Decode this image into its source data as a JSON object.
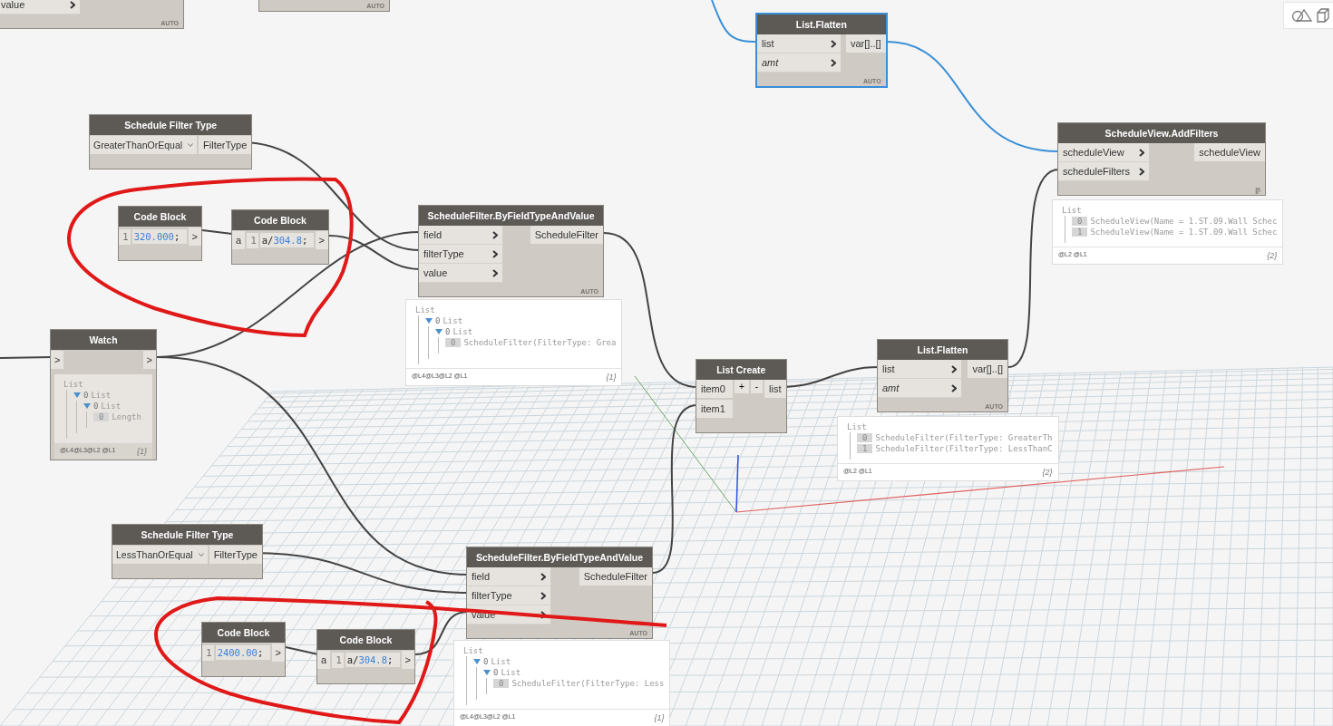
{
  "nodes": [
    {
      "kind": "function",
      "inputs": [
        {
          "label": "value",
          "optional": false
        }
      ],
      "footer": "AUTO"
    },
    {
      "kind": "function",
      "footer": "AUTO"
    },
    {
      "kind": "function",
      "title": "List.Flatten",
      "selected": true,
      "inputs": [
        {
          "label": "list",
          "optional": false
        },
        {
          "label": "amt",
          "optional": true
        }
      ],
      "outputs": [
        "var[]..[]"
      ],
      "footer": "AUTO"
    },
    {
      "kind": "function",
      "title": "ScheduleView.AddFilters",
      "selected": false,
      "inputs": [
        {
          "label": "scheduleView",
          "optional": false
        },
        {
          "label": "scheduleFilters",
          "optional": false
        }
      ],
      "outputs": [
        "scheduleView"
      ],
      "footer": "||\\",
      "preview": {
        "items": [
          {
            "label": "List",
            "children": [
              {
                "index": "0",
                "label": "ScheduleView(Name = 1.ST.09.Wall Schec"
              },
              {
                "index": "1",
                "label": "ScheduleView(Name = 1.ST.09.Wall Schec"
              }
            ]
          }
        ],
        "levels": "@L2 @L1",
        "count": "{2}"
      }
    },
    {
      "kind": "dropdown",
      "title": "Schedule Filter Type",
      "selected": false,
      "value": "GreaterThanOrEqual",
      "outputs": [
        "FilterType"
      ]
    },
    {
      "kind": "code",
      "title": "Code Block",
      "selected": false,
      "line": "1",
      "code": [
        {
          "text": "320.000",
          "kind": "number"
        },
        {
          "text": ";",
          "kind": "plain"
        }
      ],
      "outputs": [
        ">"
      ]
    },
    {
      "kind": "code",
      "title": "Code Block",
      "selected": false,
      "inputs": [
        "a"
      ],
      "line": "1",
      "code": [
        {
          "text": "a/",
          "kind": "plain"
        },
        {
          "text": "304.8",
          "kind": "number"
        },
        {
          "text": ";",
          "kind": "plain"
        }
      ],
      "outputs": [
        ">"
      ]
    },
    {
      "kind": "function",
      "title": "ScheduleFilter.ByFieldTypeAndValue",
      "selected": false,
      "inputs": [
        {
          "label": "field",
          "optional": false
        },
        {
          "label": "filterType",
          "optional": false
        },
        {
          "label": "value",
          "optional": false
        }
      ],
      "outputs": [
        "ScheduleFilter"
      ],
      "footer": "AUTO",
      "preview": {
        "items": [
          {
            "label": "List",
            "children": [
              {
                "index": "0",
                "label": "List",
                "expanded": true,
                "children": [
                  {
                    "index": "0",
                    "label": "List",
                    "expanded": true,
                    "children": [
                      {
                        "index": "0",
                        "label": "ScheduleFilter(FilterType: Grea"
                      }
                    ]
                  }
                ]
              }
            ]
          }
        ],
        "levels": "@L4@L3@L2 @L1",
        "count": "{1}"
      }
    },
    {
      "kind": "watch",
      "title": "Watch",
      "selected": false,
      "inputs": [
        ">"
      ],
      "outputs": [
        ">"
      ],
      "content": {
        "items": [
          {
            "label": "List",
            "children": [
              {
                "index": "0",
                "label": "List",
                "expanded": true,
                "children": [
                  {
                    "index": "0",
                    "label": "List",
                    "expanded": true,
                    "children": [
                      {
                        "index": "0",
                        "label": "Length"
                      }
                    ]
                  }
                ]
              }
            ]
          }
        ],
        "levels": "@L4@L3@L2 @L1",
        "count": "{1}"
      }
    },
    {
      "kind": "list-create",
      "title": "List Create",
      "selected": false,
      "inputs": [
        "item0",
        "item1"
      ],
      "buttons": [
        "+",
        "-"
      ],
      "outputs": [
        "list"
      ]
    },
    {
      "kind": "function",
      "title": "List.Flatten",
      "selected": false,
      "inputs": [
        {
          "label": "list",
          "optional": false
        },
        {
          "label": "amt",
          "optional": true
        }
      ],
      "outputs": [
        "var[]..[]"
      ],
      "footer": "AUTO",
      "preview": {
        "items": [
          {
            "label": "List",
            "children": [
              {
                "index": "0",
                "label": "ScheduleFilter(FilterType: GreaterTh"
              },
              {
                "index": "1",
                "label": "ScheduleFilter(FilterType: LessThanC"
              }
            ]
          }
        ],
        "levels": "@L2 @L1",
        "count": "{2}"
      }
    },
    {
      "kind": "dropdown",
      "title": "Schedule Filter Type",
      "selected": false,
      "value": "LessThanOrEqual",
      "outputs": [
        "FilterType"
      ]
    },
    {
      "kind": "function",
      "title": "ScheduleFilter.ByFieldTypeAndValue",
      "selected": false,
      "inputs": [
        {
          "label": "field",
          "optional": false
        },
        {
          "label": "filterType",
          "optional": false
        },
        {
          "label": "value",
          "optional": false
        }
      ],
      "outputs": [
        "ScheduleFilter"
      ],
      "footer": "AUTO",
      "preview": {
        "items": [
          {
            "label": "List",
            "children": [
              {
                "index": "0",
                "label": "List",
                "expanded": true,
                "children": [
                  {
                    "index": "0",
                    "label": "List",
                    "expanded": true,
                    "children": [
                      {
                        "index": "0",
                        "label": "ScheduleFilter(FilterType: Less"
                      }
                    ]
                  }
                ]
              }
            ]
          }
        ],
        "levels": "@L4@L3@L2 @L1",
        "count": "{1}"
      }
    },
    {
      "kind": "code",
      "title": "Code Block",
      "selected": false,
      "line": "1",
      "code": [
        {
          "text": "2400.00",
          "kind": "number"
        },
        {
          "text": ";",
          "kind": "plain"
        }
      ],
      "outputs": [
        ">"
      ]
    },
    {
      "kind": "code",
      "title": "Code Block",
      "selected": false,
      "inputs": [
        "a"
      ],
      "line": "1",
      "code": [
        {
          "text": "a/",
          "kind": "plain"
        },
        {
          "text": "304.8",
          "kind": "number"
        },
        {
          "text": ";",
          "kind": "plain"
        }
      ],
      "outputs": [
        ">"
      ]
    }
  ]
}
